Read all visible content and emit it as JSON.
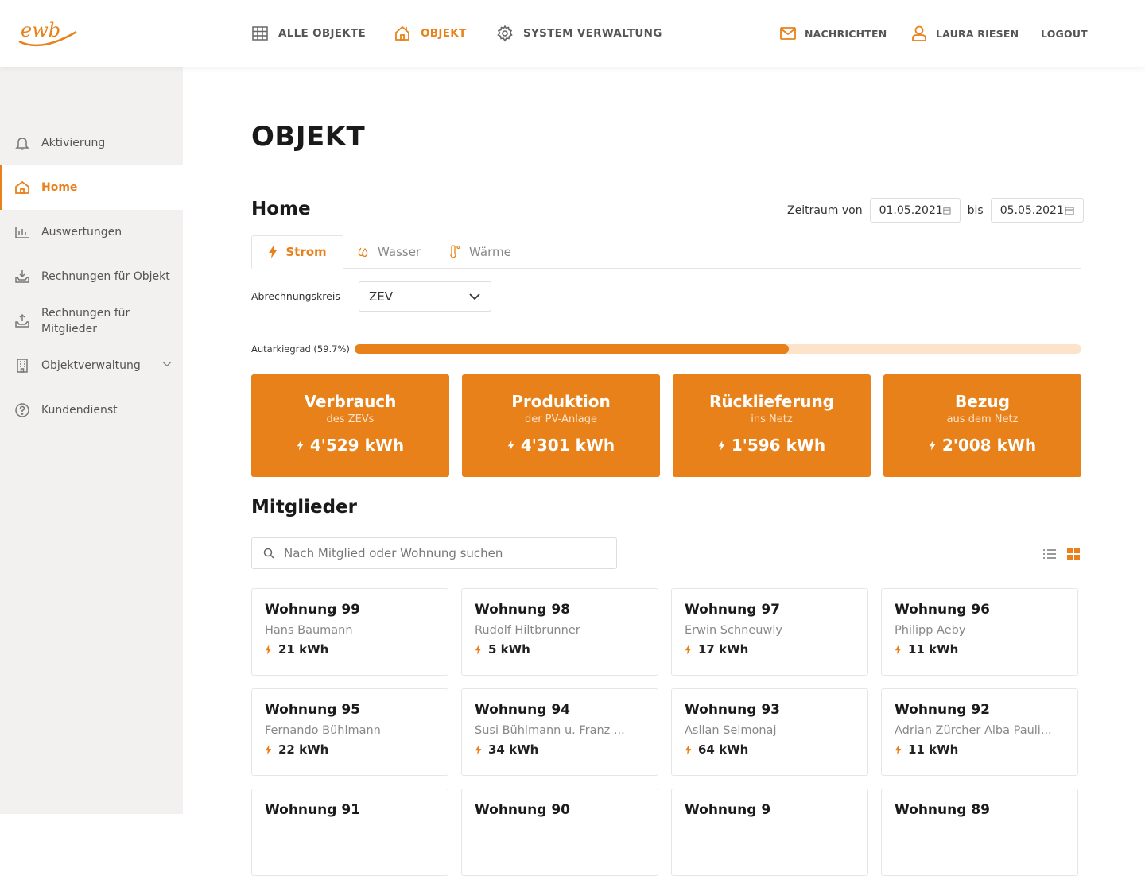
{
  "brand": {
    "logo_text": "ewb",
    "accent": "#e8811a"
  },
  "topnav": [
    {
      "label": "ALLE OBJEKTE",
      "icon": "grid-icon",
      "active": false
    },
    {
      "label": "OBJEKT",
      "icon": "home-icon",
      "active": true
    },
    {
      "label": "SYSTEM VERWALTUNG",
      "icon": "gear-icon",
      "active": false
    }
  ],
  "rightnav": {
    "messages": "NACHRICHTEN",
    "user": "LAURA RIESEN",
    "logout": "LOGOUT"
  },
  "sidebar": {
    "items": [
      {
        "label": "Aktivierung",
        "icon": "bell-icon"
      },
      {
        "label": "Home",
        "icon": "home-icon",
        "active": true
      },
      {
        "label": "Auswertungen",
        "icon": "bar-chart-icon"
      },
      {
        "label": "Rechnungen für Objekt",
        "icon": "inbox-download-icon"
      },
      {
        "label": "Rechnungen für Mitglieder",
        "icon": "inbox-upload-icon"
      },
      {
        "label": "Objektverwaltung",
        "icon": "building-icon"
      },
      {
        "label": "Kundendienst",
        "icon": "help-circle-icon"
      }
    ]
  },
  "page": {
    "title": "OBJEKT",
    "section": "Home"
  },
  "zeitraum": {
    "label_from": "Zeitraum von",
    "from": "01.05.2021",
    "label_to": "bis",
    "to": "05.05.2021"
  },
  "tabs": [
    {
      "label": "Strom",
      "icon": "bolt-icon",
      "active": true
    },
    {
      "label": "Wasser",
      "icon": "drops-icon"
    },
    {
      "label": "Wärme",
      "icon": "thermometer-icon"
    }
  ],
  "abrechnung": {
    "label": "Abrechnungskreis",
    "value": "ZEV"
  },
  "autarkie": {
    "label": "Autarkiegrad (59.7%)",
    "fraction": 0.597
  },
  "cards": [
    {
      "title": "Verbrauch",
      "sub": "des ZEVs",
      "value": "4'529 kWh"
    },
    {
      "title": "Produktion",
      "sub": "der PV-Anlage",
      "value": "4'301 kWh"
    },
    {
      "title": "Rücklieferung",
      "sub": "ins Netz",
      "value": "1'596 kWh"
    },
    {
      "title": "Bezug",
      "sub": "aus dem Netz",
      "value": "2'008 kWh"
    }
  ],
  "members": {
    "title": "Mitglieder",
    "search_placeholder": "Nach Mitglied oder Wohnung suchen",
    "items": [
      {
        "name": "Wohnung 99",
        "person": "Hans Baumann",
        "kwh": "21 kWh"
      },
      {
        "name": "Wohnung 98",
        "person": "Rudolf Hiltbrunner",
        "kwh": "5 kWh"
      },
      {
        "name": "Wohnung 97",
        "person": "Erwin Schneuwly",
        "kwh": "17 kWh"
      },
      {
        "name": "Wohnung 96",
        "person": "Philipp Aeby",
        "kwh": "11 kWh"
      },
      {
        "name": "Wohnung 95",
        "person": "Fernando Bühlmann",
        "kwh": "22 kWh"
      },
      {
        "name": "Wohnung 94",
        "person": "Susi Bühlmann u. Franz ...",
        "kwh": "34 kWh"
      },
      {
        "name": "Wohnung 93",
        "person": "Asllan Selmonaj",
        "kwh": "64 kWh"
      },
      {
        "name": "Wohnung 92",
        "person": "Adrian Zürcher Alba Pauli...",
        "kwh": "11 kWh"
      },
      {
        "name": "Wohnung 91",
        "person": "",
        "kwh": ""
      },
      {
        "name": "Wohnung 90",
        "person": "",
        "kwh": ""
      },
      {
        "name": "Wohnung 9",
        "person": "",
        "kwh": ""
      },
      {
        "name": "Wohnung 89",
        "person": "",
        "kwh": ""
      }
    ]
  }
}
